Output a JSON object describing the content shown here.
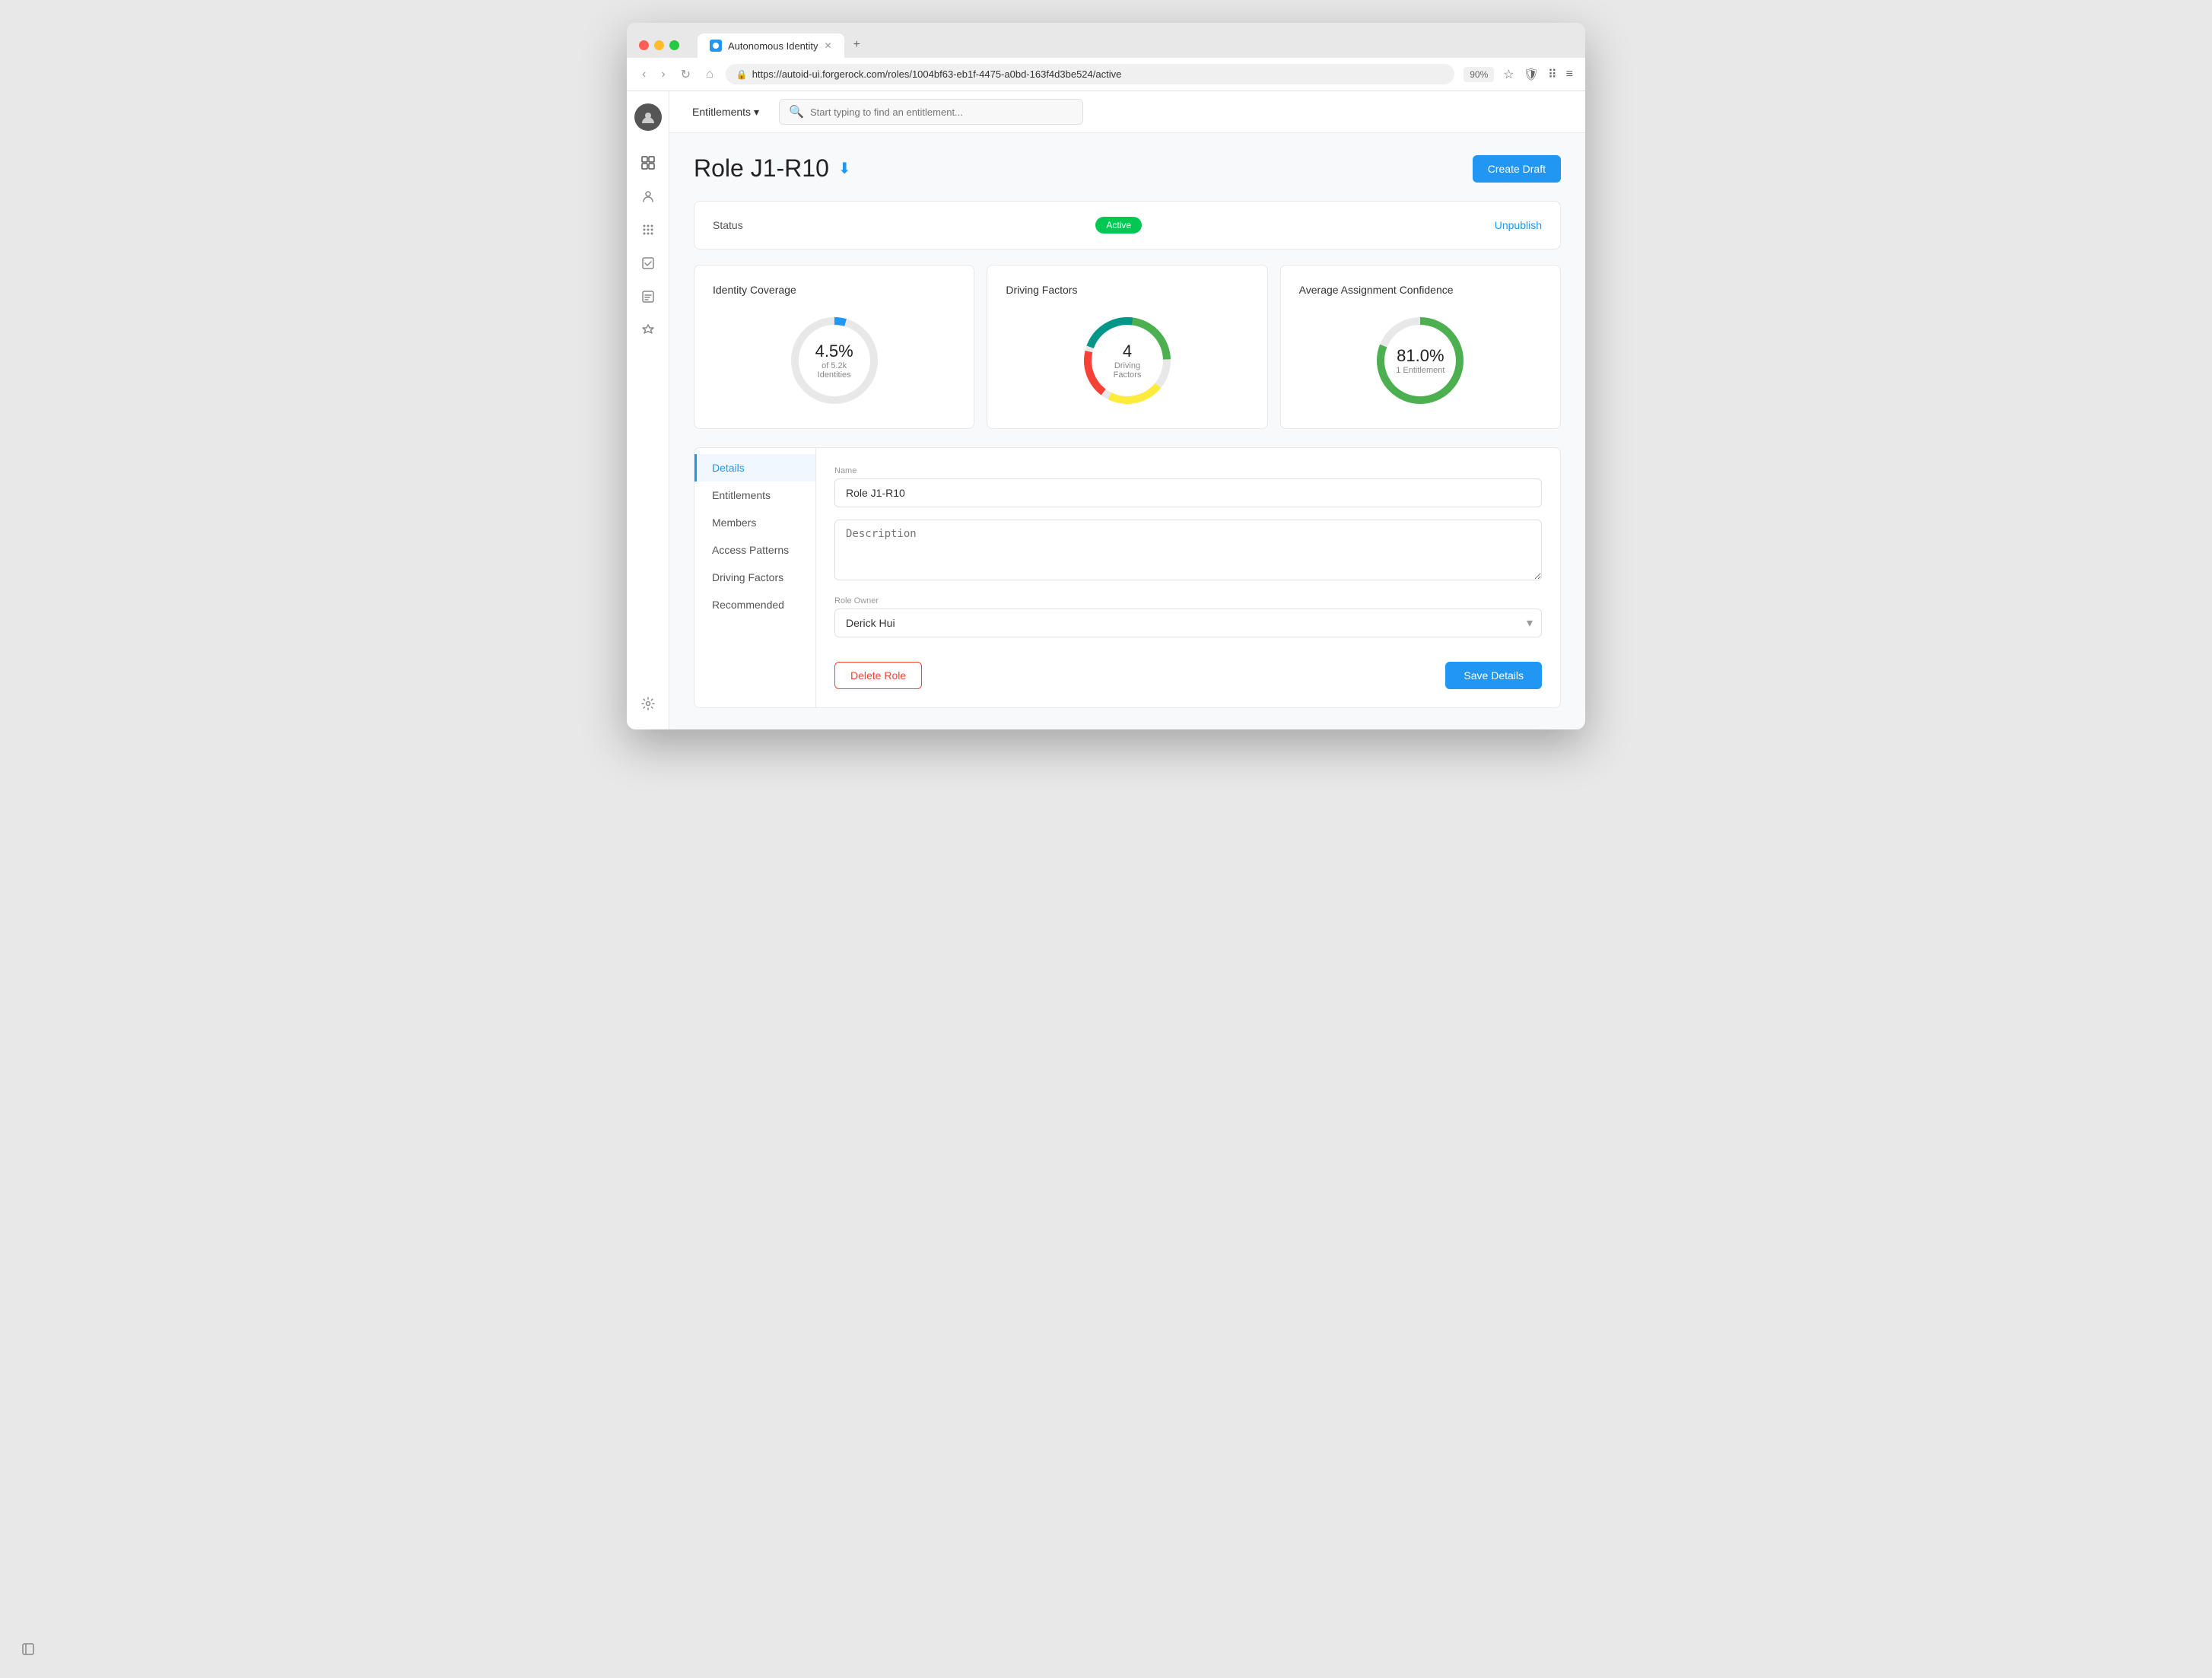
{
  "browser": {
    "tab_title": "Autonomous Identity",
    "url": "https://autoid-ui.forgerock.com/roles/1004bf63-eb1f-4475-a0bd-163f4d3be524/active",
    "zoom": "90%",
    "new_tab_label": "+"
  },
  "topnav": {
    "entitlements_label": "Entitlements",
    "search_placeholder": "Start typing to find an entitlement..."
  },
  "page": {
    "title": "Role J1-R10",
    "create_draft_label": "Create Draft"
  },
  "status_card": {
    "label": "Status",
    "badge": "Active",
    "action": "Unpublish"
  },
  "identity_coverage": {
    "title": "Identity Coverage",
    "value": "4.5%",
    "sub": "of 5.2k Identities"
  },
  "driving_factors": {
    "title": "Driving Factors",
    "value": "4",
    "sub": "Driving Factors"
  },
  "avg_confidence": {
    "title": "Average Assignment Confidence",
    "value": "81.0%",
    "sub": "1 Entitlement"
  },
  "content_nav": {
    "items": [
      {
        "label": "Details",
        "active": true
      },
      {
        "label": "Entitlements",
        "active": false
      },
      {
        "label": "Members",
        "active": false
      },
      {
        "label": "Access Patterns",
        "active": false
      },
      {
        "label": "Driving Factors",
        "active": false
      },
      {
        "label": "Recommended",
        "active": false
      }
    ]
  },
  "form": {
    "name_label": "Name",
    "name_value": "Role J1-R10",
    "description_label": "Description",
    "description_placeholder": "Description",
    "role_owner_label": "Role Owner",
    "role_owner_value": "Derick Hui",
    "delete_label": "Delete Role",
    "save_label": "Save Details"
  },
  "sidebar_icons": [
    {
      "name": "dashboard-icon",
      "symbol": "⊞"
    },
    {
      "name": "users-icon",
      "symbol": "👤"
    },
    {
      "name": "grid-icon",
      "symbol": "⠿"
    },
    {
      "name": "tasks-icon",
      "symbol": "☑"
    },
    {
      "name": "report-icon",
      "symbol": "▦"
    },
    {
      "name": "tools-icon",
      "symbol": "⚒"
    },
    {
      "name": "settings-icon",
      "symbol": "⚙"
    }
  ]
}
